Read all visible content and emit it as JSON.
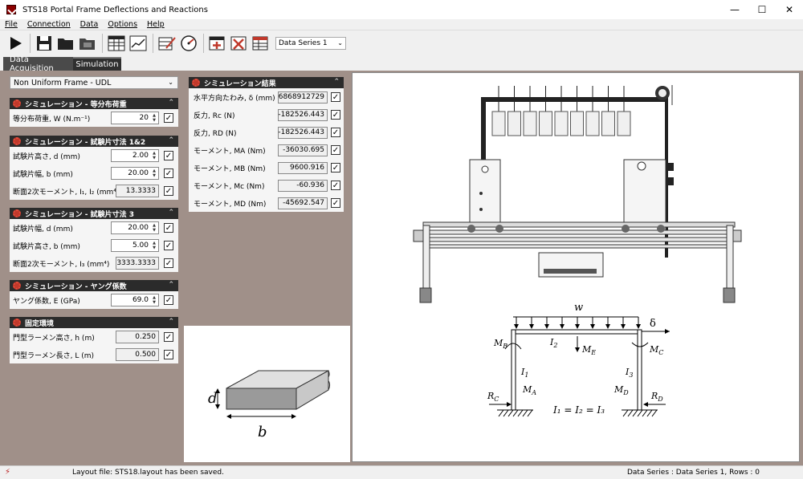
{
  "window": {
    "title": "STS18 Portal Frame Deflections and Reactions"
  },
  "menu": [
    "File",
    "Connection",
    "Data",
    "Options",
    "Help"
  ],
  "toolbar": {
    "series": "Data Series 1"
  },
  "tabs": {
    "acquisition": "Data Acquisition",
    "simulation": "Simulation"
  },
  "mode": "Non Uniform Frame - UDL",
  "groups": {
    "udl": {
      "title": "シミュレーション - 等分布荷重",
      "rows": [
        {
          "label": "等分布荷重, W (N.m⁻¹)",
          "value": "20"
        }
      ]
    },
    "dim12": {
      "title": "シミュレーション - 試験片寸法 1&2",
      "rows": [
        {
          "label": "試験片高さ, d (mm)",
          "value": "2.00"
        },
        {
          "label": "試験片幅, b (mm)",
          "value": "20.00"
        },
        {
          "label": "断面2次モーメント, I₁, I₂ (mm⁴)",
          "value": "13.3333"
        }
      ]
    },
    "dim3": {
      "title": "シミュレーション - 試験片寸法 3",
      "rows": [
        {
          "label": "試験片幅, d (mm)",
          "value": "20.00"
        },
        {
          "label": "試験片高さ, b (mm)",
          "value": "5.00"
        },
        {
          "label": "断面2次モーメント, I₃ (mm⁴)",
          "value": "3333.3333"
        }
      ]
    },
    "young": {
      "title": "シミュレーション - ヤング係数",
      "rows": [
        {
          "label": "ヤング係数, E (GPa)",
          "value": "69.0"
        }
      ]
    },
    "fixed": {
      "title": "固定環境",
      "rows": [
        {
          "label": "門型ラーメン高さ, h (m)",
          "value": "0.250"
        },
        {
          "label": "門型ラーメン長さ, L (m)",
          "value": "0.500"
        }
      ]
    }
  },
  "results": {
    "title": "シミュレーション結果",
    "rows": [
      {
        "label": "水平方向たわみ, δ (mm)",
        "value": "6868912729"
      },
      {
        "label": "反力, Rc (N)",
        "value": "-182526.443"
      },
      {
        "label": "反力, RD (N)",
        "value": "-182526.443"
      },
      {
        "label": "モーメント, MA (Nm)",
        "value": "-36030.695"
      },
      {
        "label": "モーメント, MB (Nm)",
        "value": "9600.916"
      },
      {
        "label": "モーメント, Mc (Nm)",
        "value": "-60.936"
      },
      {
        "label": "モーメント, MD (Nm)",
        "value": "-45692.547"
      }
    ]
  },
  "section_labels": {
    "d": "d",
    "b": "b"
  },
  "frame_labels": {
    "w": "w",
    "delta": "δ",
    "MB": "M",
    "MB_sub": "B",
    "MC": "M",
    "MC_sub": "C",
    "ME": "M",
    "ME_sub": "E",
    "I2": "I",
    "I2_sub": "2",
    "I1": "I",
    "I1_sub": "1",
    "I3": "I",
    "I3_sub": "3",
    "MA": "M",
    "MA_sub": "A",
    "MD": "M",
    "MD_sub": "D",
    "RC": "R",
    "RC_sub": "C",
    "RD": "R",
    "RD_sub": "D",
    "eq": "I₁ = I₂ = I₃"
  },
  "status": {
    "layout": "Layout file: STS18.layout has been saved.",
    "series": "Data Series : Data Series 1,  Rows : 0"
  },
  "colors": {
    "header": "#2b2b2b",
    "panel": "#a09089",
    "tab_active": "#2f2f2f"
  }
}
